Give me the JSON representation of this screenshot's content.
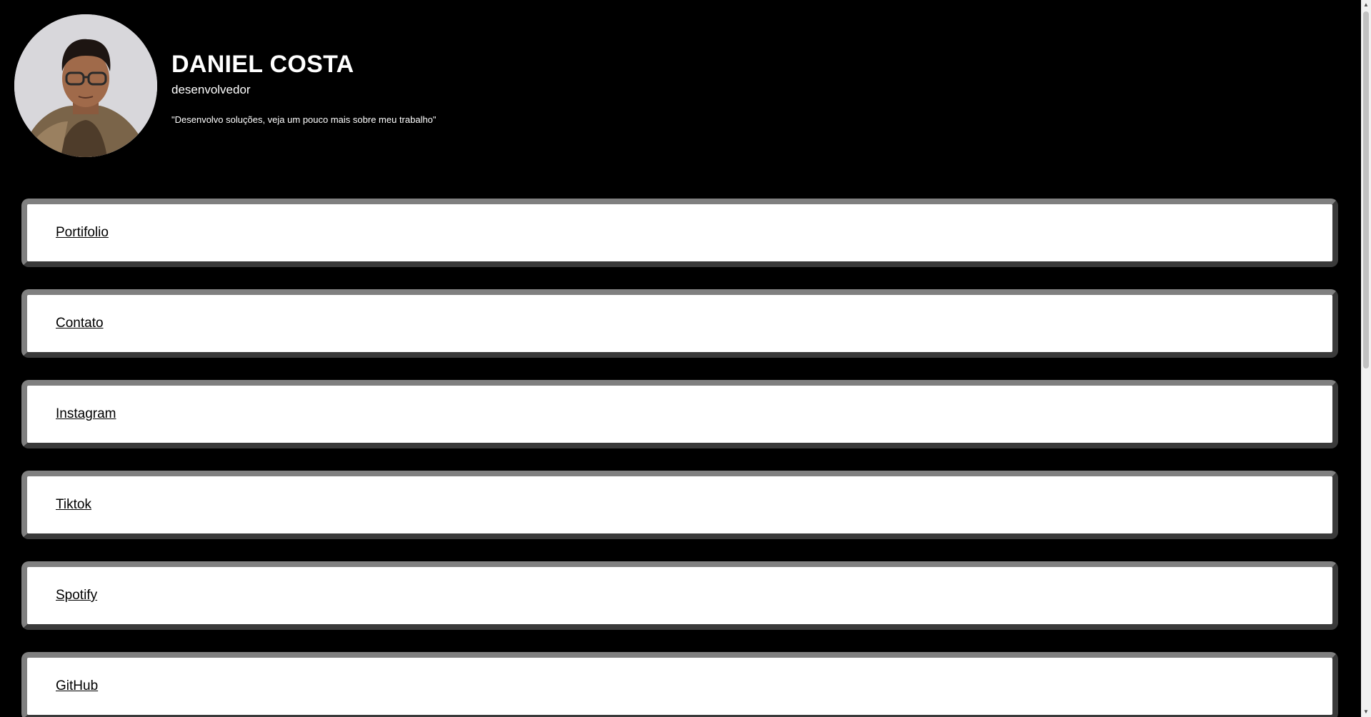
{
  "profile": {
    "name": "DANIEL COSTA",
    "role": "desenvolvedor",
    "quote": "\"Desenvolvo soluções, veja um pouco mais sobre meu trabalho\""
  },
  "links": [
    {
      "label": "Portifolio"
    },
    {
      "label": "Contato"
    },
    {
      "label": "Instagram"
    },
    {
      "label": "Tiktok"
    },
    {
      "label": "Spotify"
    },
    {
      "label": "GitHub"
    }
  ],
  "colors": {
    "background": "#000000",
    "card": "#ffffff",
    "card_border": "#808080",
    "text_header": "#ffffff",
    "text_link": "#000000"
  },
  "icons": {
    "scroll_up": "triangle-up-icon",
    "scroll_down": "triangle-down-icon"
  }
}
